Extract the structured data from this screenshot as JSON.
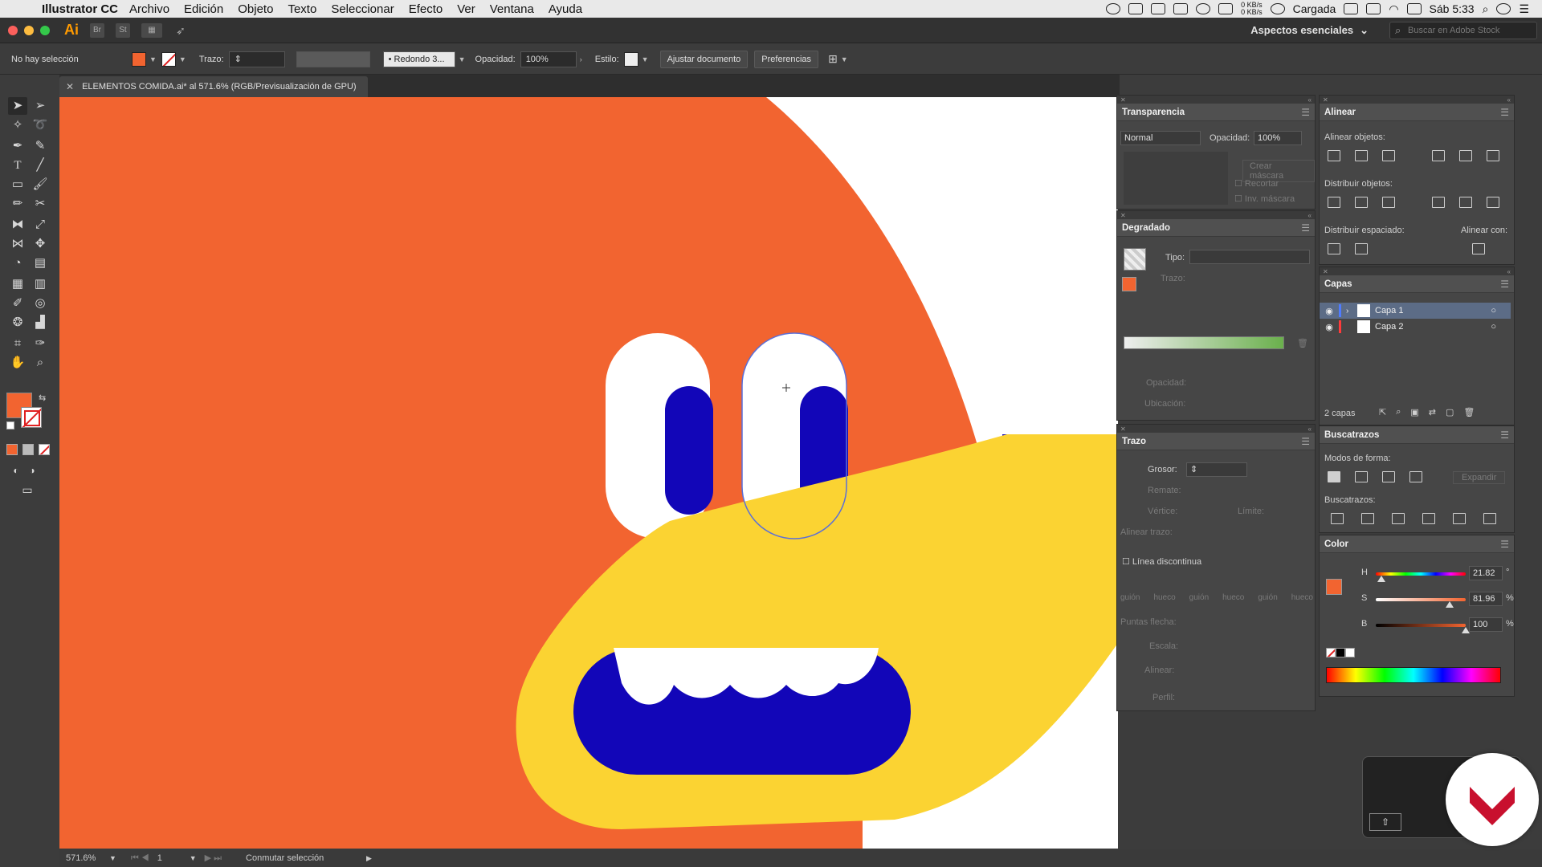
{
  "menubar": {
    "app_name": "Illustrator CC",
    "menus": [
      "Archivo",
      "Edición",
      "Objeto",
      "Texto",
      "Seleccionar",
      "Efecto",
      "Ver",
      "Ventana",
      "Ayuda"
    ],
    "net_up": "0 KB/s",
    "net_down": "0 KB/s",
    "battery_status": "Cargada",
    "clock": "Sáb 5:33"
  },
  "appbar": {
    "logo": "Ai",
    "st_label": "St",
    "workspace": "Aspectos esenciales",
    "search_placeholder": "Buscar en Adobe Stock"
  },
  "controlbar": {
    "selection_label": "No hay selección",
    "fill_color": "#f26430",
    "stroke_label": "Trazo:",
    "brush_label": "Redondo 3...",
    "opacity_label": "Opacidad:",
    "opacity_value": "100%",
    "style_label": "Estilo:",
    "fit_document_button": "Ajustar documento",
    "preferences_button": "Preferencias"
  },
  "document": {
    "tab_title": "ELEMENTOS COMIDA.ai* al 571.6% (RGB/Previsualización de GPU)"
  },
  "artwork": {
    "background_orange": "#f26430",
    "face_yellow": "#fbd332",
    "blue": "#1206b8",
    "white": "#ffffff"
  },
  "transparency_panel": {
    "title": "Transparencia",
    "blend_mode": "Normal",
    "opacity_label": "Opacidad:",
    "opacity_value": "100%",
    "make_mask_button": "Crear máscara",
    "clip_label": "Recortar",
    "invert_mask_label": "Inv. máscara"
  },
  "gradient_panel": {
    "title": "Degradado",
    "type_label": "Tipo:",
    "stroke_label": "Trazo:",
    "opacity_label": "Opacidad:",
    "location_label": "Ubicación:"
  },
  "stroke_panel": {
    "title": "Trazo",
    "weight_label": "Grosor:",
    "cap_label": "Remate:",
    "corner_label": "Vértice:",
    "limit_label": "Límite:",
    "align_label": "Alinear trazo:",
    "dashed_label": "Línea discontinua",
    "dash_fields": [
      "guión",
      "hueco",
      "guión",
      "hueco",
      "guión",
      "hueco"
    ],
    "arrowheads_label": "Puntas flecha:",
    "scale_label": "Escala:",
    "align_arrows_label": "Alinear:",
    "profile_label": "Perfil:"
  },
  "align_panel": {
    "title": "Alinear",
    "align_objects_label": "Alinear objetos:",
    "distribute_objects_label": "Distribuir objetos:",
    "distribute_spacing_label": "Distribuir espaciado:",
    "align_to_label": "Alinear con:"
  },
  "layers_panel": {
    "title": "Capas",
    "layers": [
      {
        "name": "Capa 1",
        "color": "#4f7cff"
      },
      {
        "name": "Capa 2",
        "color": "#ff3b3b"
      }
    ],
    "count_label": "2 capas"
  },
  "pathfinder_panel": {
    "title": "Buscatrazos",
    "shape_modes_label": "Modos de forma:",
    "expand_button": "Expandir",
    "pathfinders_label": "Buscatrazos:"
  },
  "color_panel": {
    "title": "Color",
    "h_label": "H",
    "h_value": "21.82",
    "h_unit": "°",
    "s_label": "S",
    "s_value": "81.96",
    "s_unit": "%",
    "b_label": "B",
    "b_value": "100",
    "b_unit": "%",
    "h_fraction": 0.06,
    "s_fraction": 0.82,
    "b_fraction": 1.0
  },
  "statusbar": {
    "zoom": "571.6%",
    "artboard": "1",
    "status_text": "Conmutar selección"
  }
}
